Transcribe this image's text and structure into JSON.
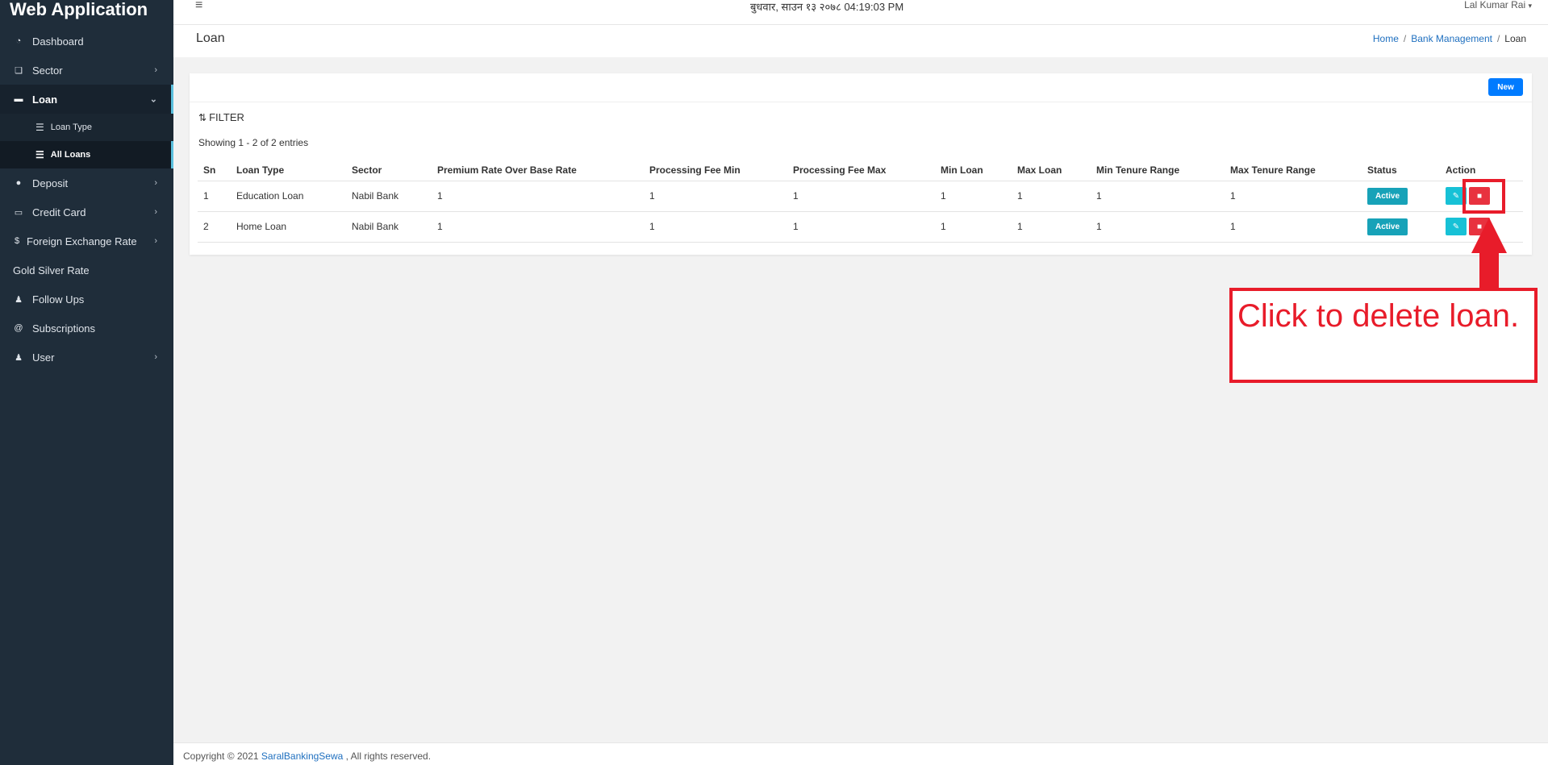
{
  "app": {
    "brand": "Web Application"
  },
  "sidebar": {
    "items": [
      {
        "label": "Dashboard",
        "icon": "dashboard-icon"
      },
      {
        "label": "Sector",
        "icon": "sector-icon"
      },
      {
        "label": "Loan",
        "icon": "loan-icon"
      },
      {
        "label": "Deposit",
        "icon": "piggy-bank-icon"
      },
      {
        "label": "Credit Card",
        "icon": "credit-card-icon"
      },
      {
        "label": "Foreign Exchange Rate",
        "icon": "dollar-icon"
      },
      {
        "label": "Gold Silver Rate"
      },
      {
        "label": "Follow Ups",
        "icon": "user-plus-icon"
      },
      {
        "label": "Subscriptions",
        "icon": "at-icon"
      },
      {
        "label": "User",
        "icon": "users-icon"
      }
    ],
    "loan_sub": [
      {
        "label": "Loan Type",
        "icon": "list-icon"
      },
      {
        "label": "All Loans",
        "icon": "list-icon"
      }
    ]
  },
  "topbar": {
    "datetime": "बुधवार, साउन १३ २०७८ 04:19:03 PM",
    "user": "Lal Kumar Rai"
  },
  "page": {
    "title": "Loan",
    "breadcrumb": [
      "Home",
      "Bank Management",
      "Loan"
    ]
  },
  "card": {
    "new_label": "New",
    "filter_label": "FILTER",
    "showing": "Showing 1 - 2 of 2 entries"
  },
  "table": {
    "columns": [
      "Sn",
      "Loan Type",
      "Sector",
      "Premium Rate Over Base Rate",
      "Processing Fee Min",
      "Processing Fee Max",
      "Min Loan",
      "Max Loan",
      "Min Tenure Range",
      "Max Tenure Range",
      "Status",
      "Action"
    ],
    "rows": [
      {
        "sn": "1",
        "loan_type": "Education Loan",
        "sector": "Nabil Bank",
        "premium": "1",
        "fee_min": "1",
        "fee_max": "1",
        "min_loan": "1",
        "max_loan": "1",
        "min_tenure": "1",
        "max_tenure": "1",
        "status": "Active"
      },
      {
        "sn": "2",
        "loan_type": "Home Loan",
        "sector": "Nabil Bank",
        "premium": "1",
        "fee_min": "1",
        "fee_max": "1",
        "min_loan": "1",
        "max_loan": "1",
        "min_tenure": "1",
        "max_tenure": "1",
        "status": "Active"
      }
    ]
  },
  "annotation": {
    "text": "Click to delete loan.",
    "color": "#e81c2a"
  },
  "footer": {
    "prefix": "Copyright © 2021",
    "link": "SaralBankingSewa",
    "suffix": ", All rights reserved."
  }
}
